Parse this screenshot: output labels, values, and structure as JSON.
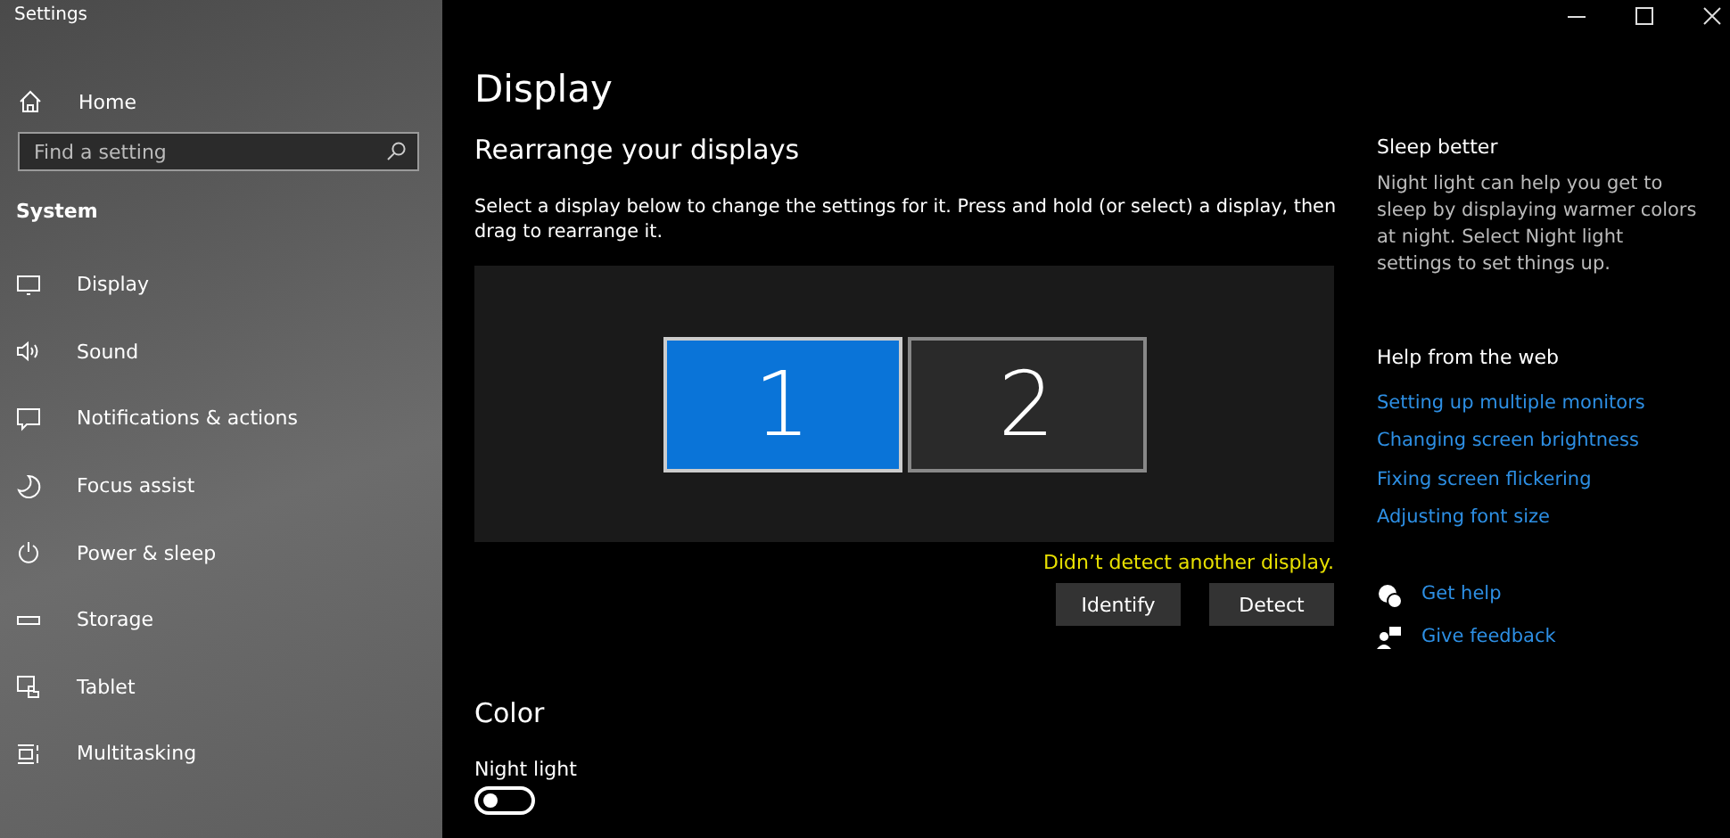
{
  "window": {
    "title": "Settings"
  },
  "sidebar": {
    "home": "Home",
    "search": {
      "placeholder": "Find a setting"
    },
    "section": "System",
    "items": [
      {
        "label": "Display"
      },
      {
        "label": "Sound"
      },
      {
        "label": "Notifications & actions"
      },
      {
        "label": "Focus assist"
      },
      {
        "label": "Power & sleep"
      },
      {
        "label": "Storage"
      },
      {
        "label": "Tablet"
      },
      {
        "label": "Multitasking"
      }
    ]
  },
  "main": {
    "title": "Display",
    "heading": "Rearrange your displays",
    "description": "Select a display below to change the settings for it. Press and hold (or select) a display, then drag to rearrange it.",
    "displays": [
      {
        "label": "1",
        "selected": true
      },
      {
        "label": "2",
        "selected": false
      }
    ],
    "warning": "Didn’t detect another display.",
    "buttons": [
      "Identify",
      "Detect"
    ],
    "color_heading": "Color",
    "night_light_label": "Night light",
    "night_light": {
      "on": false
    }
  },
  "aside": {
    "sleep_title": "Sleep better",
    "sleep_text": "Night light can help you get to sleep by displaying warmer colors at night. Select Night light settings to set things up.",
    "help_title": "Help from the web",
    "links": [
      "Setting up multiple monitors",
      "Changing screen brightness",
      "Fixing screen flickering",
      "Adjusting font size"
    ],
    "actions": [
      "Get help",
      "Give feedback"
    ]
  }
}
